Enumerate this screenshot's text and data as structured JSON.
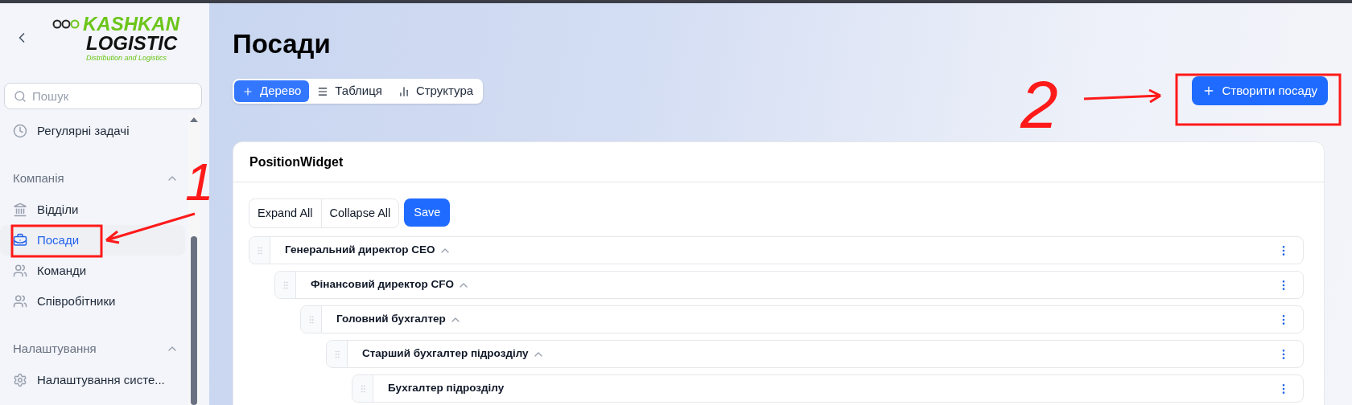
{
  "sidebar": {
    "logo": {
      "line1": "KASHKAN",
      "line2": "LOGISTIC",
      "tagline": "Distribution and Logistics"
    },
    "search": {
      "placeholder": "Пошук"
    },
    "items": [
      {
        "kind": "item",
        "label": "Регулярні задачі",
        "selected": false
      },
      {
        "kind": "section",
        "label": "Компанія",
        "expanded": true
      },
      {
        "kind": "item",
        "label": "Відділи",
        "selected": false
      },
      {
        "kind": "item",
        "label": "Посади",
        "selected": true
      },
      {
        "kind": "item",
        "label": "Команди",
        "selected": false
      },
      {
        "kind": "item",
        "label": "Співробітники",
        "selected": false
      },
      {
        "kind": "section",
        "label": "Налаштування",
        "expanded": true
      },
      {
        "kind": "item",
        "label": "Налаштування систе...",
        "selected": false
      }
    ]
  },
  "page": {
    "title": "Посади",
    "views": [
      {
        "label": "Дерево",
        "selected": true
      },
      {
        "label": "Таблиця",
        "selected": false
      },
      {
        "label": "Структура",
        "selected": false
      }
    ],
    "create_button": "Створити посаду"
  },
  "widget": {
    "title": "PositionWidget",
    "buttons": [
      {
        "kind": "outline",
        "label": "Expand All"
      },
      {
        "kind": "outline",
        "label": "Collapse All"
      },
      {
        "kind": "primary",
        "label": "Save"
      }
    ],
    "tree": [
      {
        "title": "Генеральний директор CEO",
        "expanded": true,
        "children": [
          {
            "title": "Фінансовий директор CFO",
            "expanded": true,
            "children": [
              {
                "title": "Головний бухгалтер",
                "expanded": true,
                "children": [
                  {
                    "title": "Старший бухгалтер підрозділу",
                    "expanded": true,
                    "children": [
                      {
                        "title": "Бухгалтер підрозділу"
                      }
                    ]
                  }
                ]
              }
            ]
          }
        ]
      }
    ]
  },
  "annotations": [
    {
      "label": "1"
    },
    {
      "label": "2"
    }
  ]
}
